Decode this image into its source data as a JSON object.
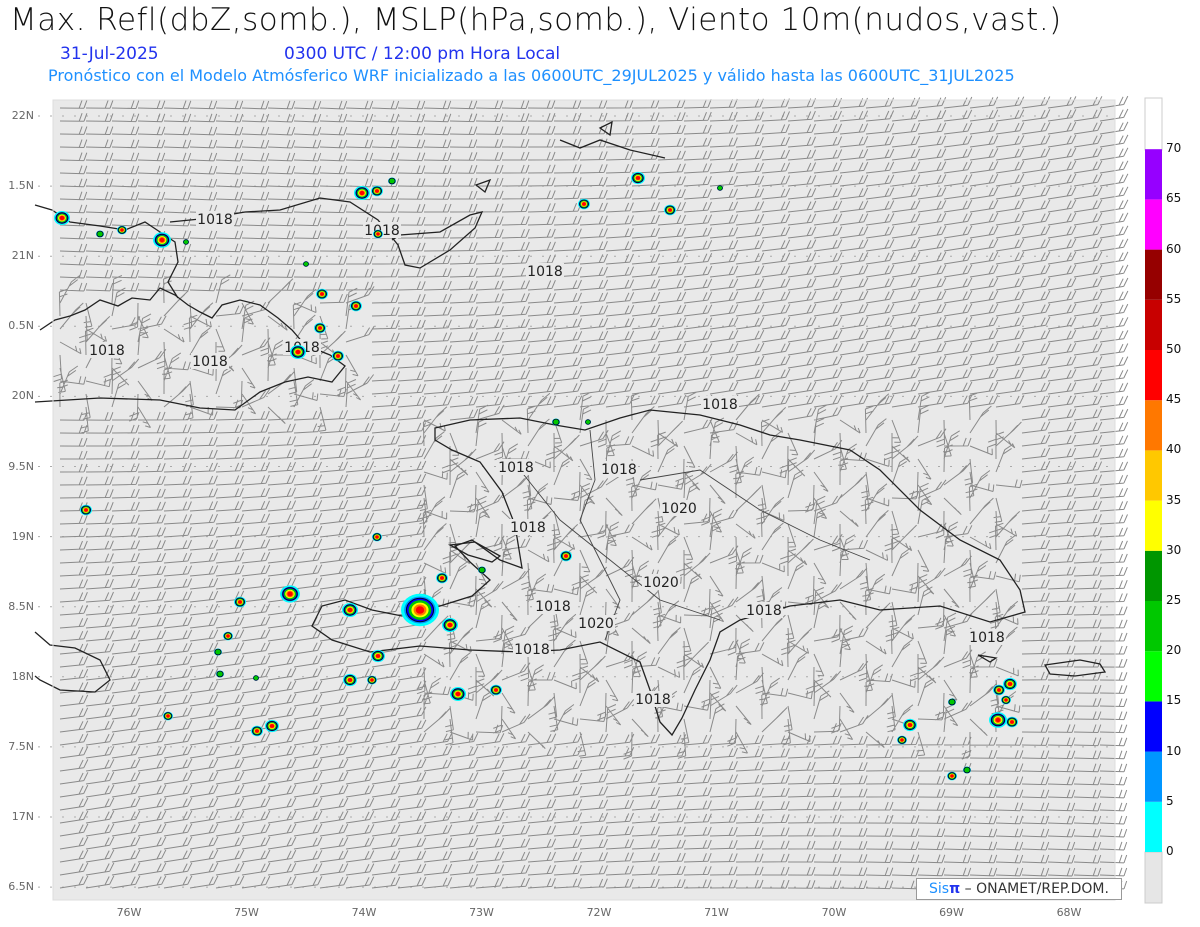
{
  "header": {
    "title": "Max. Refl(dbZ,somb.), MSLP(hPa,somb.), Viento 10m(nudos,vast.)",
    "date": "31-Jul-2025",
    "time": "0300 UTC / 12:00 pm Hora Local",
    "description": "Pronóstico con el Modelo Atmósferico WRF inicializado a las 0600UTC_29JUL2025 y válido hasta las  0600UTC_31JUL2025"
  },
  "lat_labels": [
    "22N",
    "1.5N",
    "21N",
    "0.5N",
    "20N",
    "9.5N",
    "19N",
    "8.5N",
    "18N",
    "7.5N",
    "17N",
    "6.5N"
  ],
  "lon_labels": [
    "76W",
    "75W",
    "74W",
    "73W",
    "72W",
    "71W",
    "70W",
    "69W",
    "68W"
  ],
  "pressure_labels": [
    "1018",
    "1018",
    "1018",
    "1018",
    "1018",
    "1018",
    "1018",
    "1018",
    "1018",
    "1020",
    "1018",
    "1020",
    "1018",
    "1020",
    "1018",
    "1018",
    "1018",
    "1018"
  ],
  "colorbar": {
    "labels": [
      "0",
      "5",
      "10",
      "15",
      "20",
      "25",
      "30",
      "35",
      "40",
      "45",
      "50",
      "55",
      "60",
      "65",
      "70"
    ],
    "colors": [
      "#00ffff",
      "#0096ff",
      "#0000ff",
      "#00ff00",
      "#00c800",
      "#009600",
      "#ffff00",
      "#ffc800",
      "#ff7800",
      "#ff0000",
      "#c80000",
      "#960000",
      "#ff00ff",
      "#9600ff"
    ]
  },
  "credit": {
    "brand_a": "Sis",
    "brand_b": "π",
    "text": " – ONAMET/REP.DOM."
  }
}
